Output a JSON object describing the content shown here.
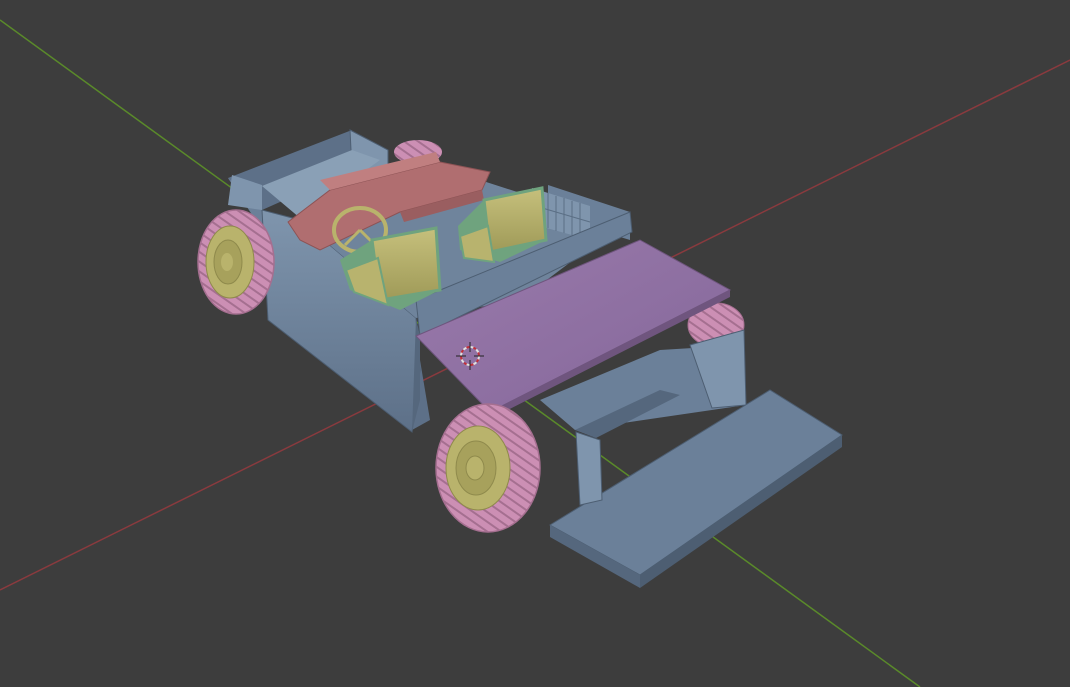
{
  "viewport": {
    "background": "#3d3d3d",
    "x_axis_color": "#8a3a3e",
    "y_axis_color": "#5a8a2a"
  },
  "colors": {
    "body": "#6b8099",
    "body_light": "#7f95ad",
    "body_dark": "#55677d",
    "hood": "#8c6d9e",
    "hood_dark": "#6f557e",
    "dashboard": "#b06e70",
    "seat": "#b8b36e",
    "seat_trim": "#6fa37e",
    "tire": "#cc8fb4",
    "rim": "#b9b36c"
  },
  "scene": {
    "object": "car-chassis",
    "cursor": "3d-cursor-icon"
  }
}
